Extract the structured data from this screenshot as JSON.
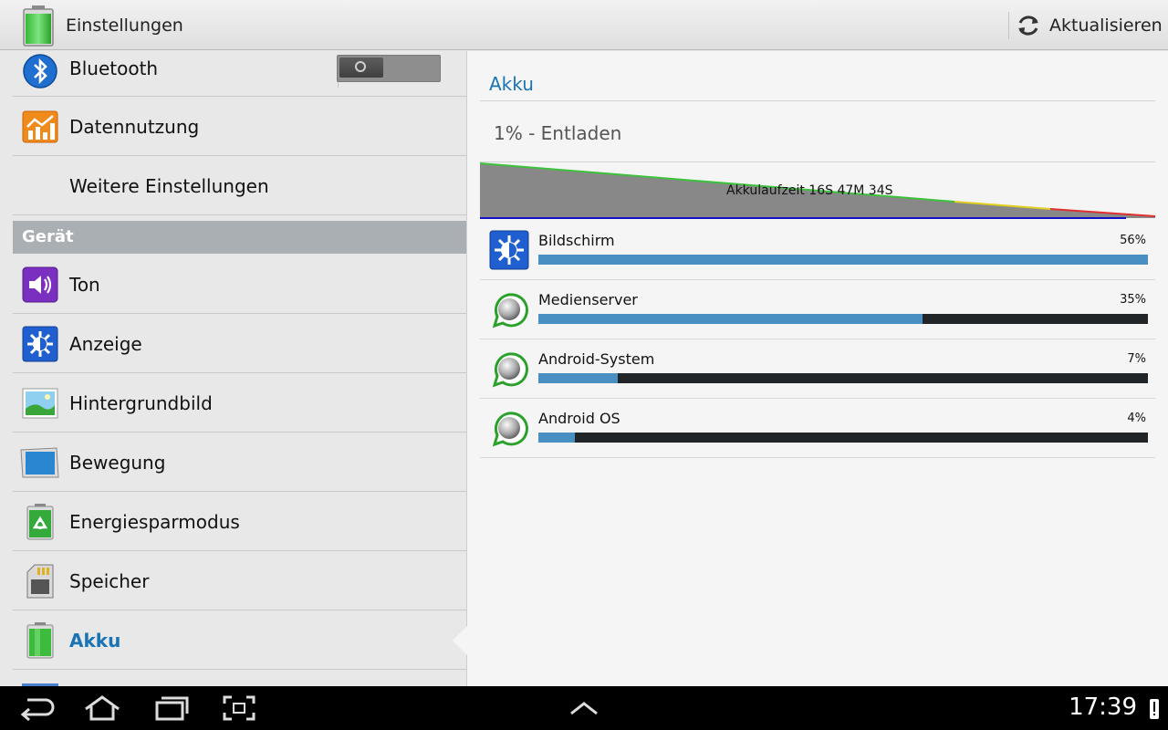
{
  "actionbar": {
    "title": "Einstellungen",
    "refresh_label": "Aktualisieren",
    "app_icon": "battery-icon",
    "refresh_icon": "refresh-icon"
  },
  "sidebar": {
    "section_device": "Gerät",
    "items": [
      {
        "label": "Bluetooth",
        "icon": "bluetooth-icon"
      },
      {
        "label": "Datennutzung",
        "icon": "data-usage-icon"
      },
      {
        "label": "Weitere Einstellungen",
        "icon": ""
      },
      {
        "label": "Ton",
        "icon": "sound-icon"
      },
      {
        "label": "Anzeige",
        "icon": "display-icon"
      },
      {
        "label": "Hintergrundbild",
        "icon": "wallpaper-icon"
      },
      {
        "label": "Bewegung",
        "icon": "motion-icon"
      },
      {
        "label": "Energiesparmodus",
        "icon": "power-saving-icon"
      },
      {
        "label": "Speicher",
        "icon": "storage-icon"
      },
      {
        "label": "Akku",
        "icon": "battery-icon",
        "active": true
      }
    ],
    "bluetooth_toggle": {
      "state": "off"
    }
  },
  "battery": {
    "title": "Akku",
    "status": "1% - Entladen",
    "graph_label": "Akkulaufzeit 16S 47M 34S",
    "colors": {
      "accent": "#1a73b5",
      "bar_fill": "#4a8fc2",
      "bar_track": "#222528",
      "graph_green": "#3cc23c",
      "graph_yellow": "#e0d020",
      "graph_red": "#e03030",
      "graph_baseline": "#1010c8"
    },
    "usage": [
      {
        "name": "Bildschirm",
        "percent_label": "56%",
        "fraction": 1.0,
        "icon": "display-icon"
      },
      {
        "name": "Medienserver",
        "percent_label": "35%",
        "fraction": 0.63,
        "icon": "android-system-icon"
      },
      {
        "name": "Android-System",
        "percent_label": "7%",
        "fraction": 0.13,
        "icon": "android-system-icon"
      },
      {
        "name": "Android OS",
        "percent_label": "4%",
        "fraction": 0.06,
        "icon": "android-system-icon"
      }
    ]
  },
  "statusbar": {
    "time": "17:39",
    "nav_icons": [
      "back-icon",
      "home-icon",
      "recent-apps-icon",
      "screenshot-icon",
      "up-arrow-icon"
    ]
  }
}
